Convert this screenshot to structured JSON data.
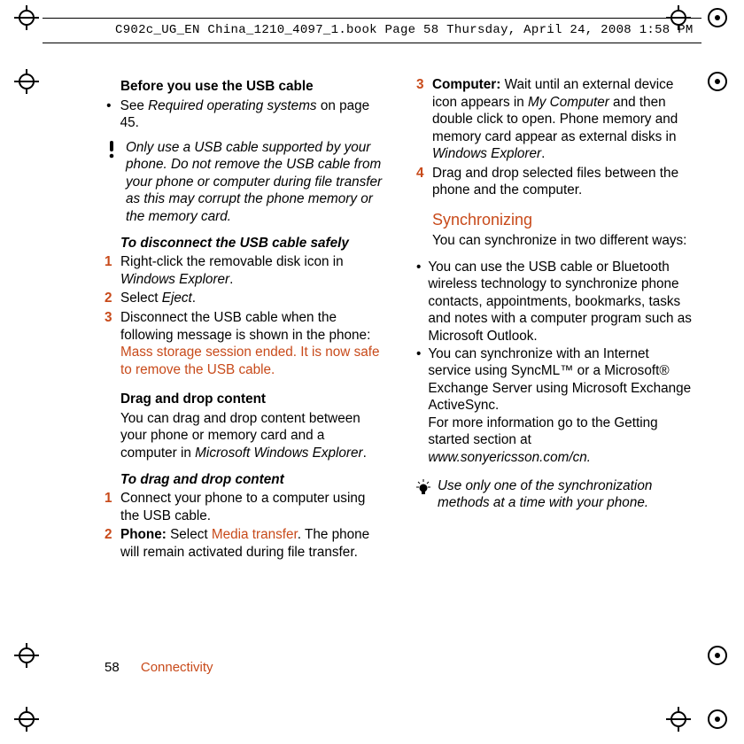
{
  "meta": {
    "bookline": "C902c_UG_EN China_1210_4097_1.book  Page 58  Thursday, April 24, 2008  1:58 PM"
  },
  "col1": {
    "h_before": "Before you use the USB cable",
    "see_before": "See ",
    "see_term": "Required operating systems",
    "see_after": " on page 45.",
    "warn": "Only use a USB cable supported by your phone. Do not remove the USB cable from your phone or computer during file transfer as this may corrupt the phone memory or the memory card.",
    "disconnect_h": "To disconnect the USB cable safely",
    "d1_a": "Right-click the removable disk icon in ",
    "d1_b": "Windows Explorer",
    "d1_c": ".",
    "d2_a": "Select ",
    "d2_b": "Eject",
    "d2_c": ".",
    "d3_a": "Disconnect the USB cable when the following message is shown in the phone: ",
    "d3_b": "Mass storage session ended. It is now safe to remove the USB cable.",
    "drag_h": "Drag and drop content",
    "drag_p_a": "You can drag and drop content between your phone or memory card and a computer in ",
    "drag_p_b": "Microsoft Windows Explorer",
    "drag_p_c": ".",
    "tdrag_h": "To drag and drop content",
    "t1": "Connect your phone to a computer using the USB cable.",
    "t2_a": "Phone:",
    "t2_b": " Select ",
    "t2_c": "Media transfer",
    "t2_d": ". The phone will remain activated during file transfer."
  },
  "col2": {
    "t3_a": "Computer:",
    "t3_b": " Wait until an external device icon appears in ",
    "t3_c": "My Computer",
    "t3_d": " and then double click to open. Phone memory and memory card appear as external disks in ",
    "t3_e": "Windows Explorer",
    "t3_f": ".",
    "t4": "Drag and drop selected files between the phone and the computer.",
    "sync_h": "Synchronizing",
    "sync_intro": "You can synchronize in two different ways:",
    "b1": "You can use the USB cable or Bluetooth wireless technology to synchronize phone contacts, appointments, bookmarks, tasks and notes with a computer program such as Microsoft Outlook.",
    "b2_a": "You can synchronize with an Internet service using SyncML™ or a Microsoft® Exchange Server using Microsoft Exchange ActiveSync.",
    "b2_b": "For more information go to the Getting started section at",
    "b2_c": "www.sonyericsson.com/cn.",
    "tip": "Use only one of the synchronization methods at a time with your phone."
  },
  "footer": {
    "page": "58",
    "section": "Connectivity"
  },
  "steps": {
    "n1": "1",
    "n2": "2",
    "n3": "3",
    "n4": "4"
  },
  "bullets": {
    "dot": "•"
  }
}
